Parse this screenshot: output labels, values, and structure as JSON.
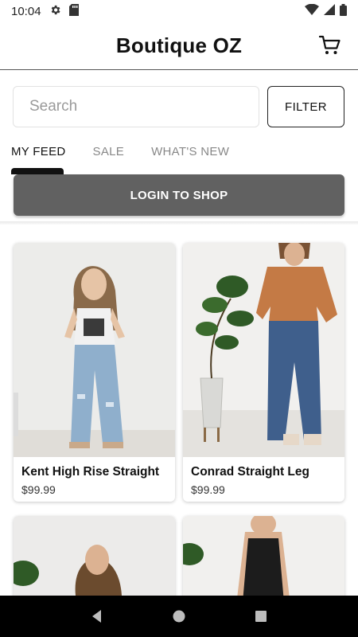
{
  "status_bar": {
    "time": "10:04",
    "icons": [
      "gear-icon",
      "sd-card-icon",
      "wifi-icon",
      "signal-icon",
      "battery-icon"
    ]
  },
  "header": {
    "title": "Boutique OZ",
    "cart_icon": "cart-icon"
  },
  "search": {
    "placeholder": "Search",
    "value": "",
    "filter_label": "FILTER"
  },
  "tabs": [
    {
      "label": "MY FEED",
      "active": true
    },
    {
      "label": "SALE",
      "active": false
    },
    {
      "label": "WHAT'S NEW",
      "active": false
    }
  ],
  "login_label": "LOGIN TO SHOP",
  "products": [
    {
      "name": "Kent High Rise Straight",
      "price": "$99.99"
    },
    {
      "name": "Conrad Straight Leg",
      "price": "$99.99"
    },
    {
      "name": "",
      "price": ""
    },
    {
      "name": "",
      "price": ""
    }
  ],
  "colors": {
    "accent": "#111111",
    "login_bg": "#616161",
    "nav_bg": "#000000"
  },
  "nav": [
    "back-icon",
    "home-icon",
    "recents-icon"
  ]
}
